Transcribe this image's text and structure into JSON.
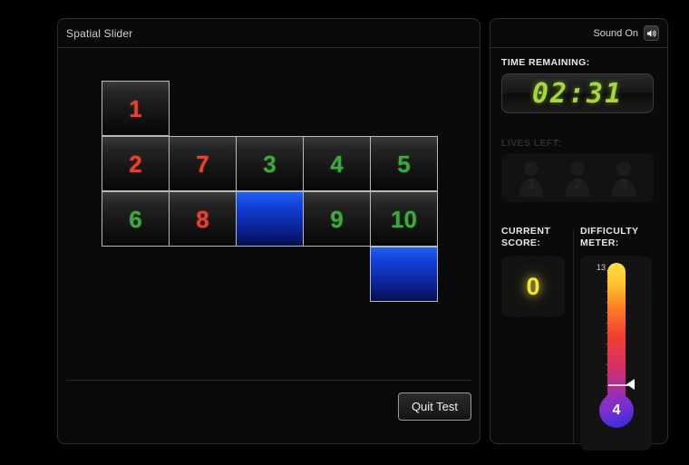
{
  "game": {
    "title": "Spatial Slider",
    "quit_label": "Quit Test",
    "grid": {
      "rows": 4,
      "cols": 5,
      "tiles": [
        {
          "row": 0,
          "col": 0,
          "label": "1",
          "state": "number",
          "color": "red"
        },
        {
          "row": 1,
          "col": 0,
          "label": "2",
          "state": "number",
          "color": "red"
        },
        {
          "row": 1,
          "col": 1,
          "label": "7",
          "state": "number",
          "color": "red"
        },
        {
          "row": 1,
          "col": 2,
          "label": "3",
          "state": "number",
          "color": "green"
        },
        {
          "row": 1,
          "col": 3,
          "label": "4",
          "state": "number",
          "color": "green"
        },
        {
          "row": 1,
          "col": 4,
          "label": "5",
          "state": "number",
          "color": "green"
        },
        {
          "row": 2,
          "col": 0,
          "label": "6",
          "state": "number",
          "color": "green"
        },
        {
          "row": 2,
          "col": 1,
          "label": "8",
          "state": "number",
          "color": "red"
        },
        {
          "row": 2,
          "col": 2,
          "label": "",
          "state": "blue",
          "color": ""
        },
        {
          "row": 2,
          "col": 3,
          "label": "9",
          "state": "number",
          "color": "green"
        },
        {
          "row": 2,
          "col": 4,
          "label": "10",
          "state": "number",
          "color": "green"
        },
        {
          "row": 3,
          "col": 4,
          "label": "",
          "state": "blue",
          "color": ""
        }
      ]
    }
  },
  "status": {
    "sound": {
      "label": "Sound On",
      "icon": "speaker-on-icon"
    },
    "time": {
      "label": "Time Remaining:",
      "value": "02:31"
    },
    "lives": {
      "label": "Lives Left:",
      "items": [
        {
          "number": "1"
        },
        {
          "number": "2"
        },
        {
          "number": "3"
        }
      ]
    },
    "score": {
      "label": "Current Score:",
      "value": "0"
    },
    "difficulty": {
      "label": "Difficulty Meter:",
      "value": "4",
      "scale_max": "13",
      "scale_min": "1"
    }
  },
  "colors": {
    "background": "#000000",
    "panel": "#0a0a0a",
    "panel_border": "#2e2e2e",
    "tile_border": "#b9b9b9",
    "number_red": "#e8412e",
    "number_green": "#3fa93f",
    "tile_blue": "#1340d8",
    "timer_green": "#a4d83c",
    "score_yellow": "#f2e53a",
    "thermo_top": "#ffe14a",
    "thermo_bottom": "#2a2ee0"
  }
}
